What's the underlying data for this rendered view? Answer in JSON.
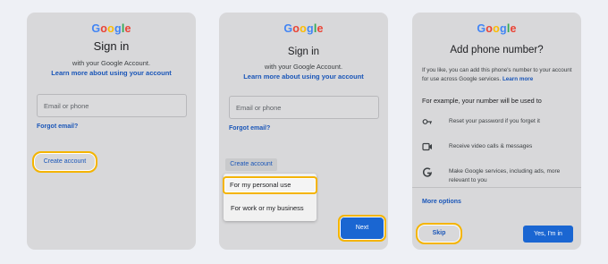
{
  "brand": {
    "letters": [
      {
        "ch": "G",
        "color": "#4285F4"
      },
      {
        "ch": "o",
        "color": "#EA4335"
      },
      {
        "ch": "o",
        "color": "#FBBC05"
      },
      {
        "ch": "g",
        "color": "#4285F4"
      },
      {
        "ch": "l",
        "color": "#34A853"
      },
      {
        "ch": "e",
        "color": "#EA4335"
      }
    ]
  },
  "colors": {
    "highlight": "#f4b400",
    "link": "#1a56b8",
    "primary_button": "#1a66d2"
  },
  "panel1": {
    "title": "Sign in",
    "subtitle": "with your Google Account.",
    "learn_more": "Learn more about using your account",
    "email_placeholder": "Email or phone",
    "forgot_email": "Forgot email?",
    "create_account": "Create account"
  },
  "panel2": {
    "title": "Sign in",
    "subtitle": "with your Google Account.",
    "learn_more": "Learn more about using your account",
    "email_placeholder": "Email or phone",
    "forgot_email": "Forgot email?",
    "create_account": "Create account",
    "menu": {
      "personal": "For my personal use",
      "business": "For work or my business"
    },
    "next": "Next"
  },
  "panel3": {
    "title": "Add phone number?",
    "intro": "If you like, you can add this phone's number to your account for use across Google services.",
    "learn_more": "Learn more",
    "example_heading": "For example, your number will be used to",
    "items": [
      {
        "icon": "key-icon",
        "text": "Reset your password if you forget it"
      },
      {
        "icon": "video-icon",
        "text": "Receive video calls & messages"
      },
      {
        "icon": "google-g-icon",
        "text": "Make Google services, including ads, more relevant to you"
      }
    ],
    "more_options": "More options",
    "skip": "Skip",
    "confirm": "Yes, I'm in"
  }
}
